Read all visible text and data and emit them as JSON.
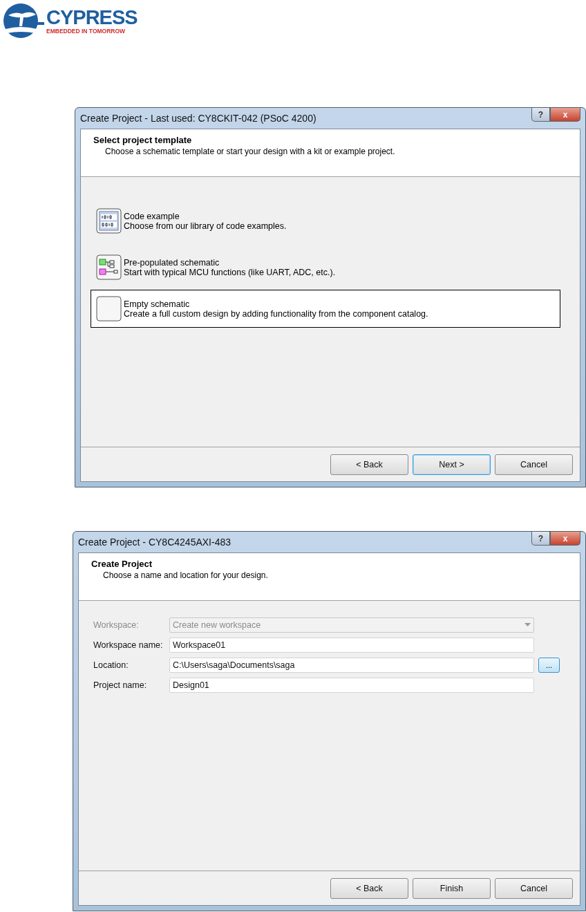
{
  "logo": {
    "name": "CYPRESS",
    "tagline": "EMBEDDED IN TOMORROW"
  },
  "template_dialog": {
    "title": "Create Project - Last used: CY8CKIT-042 (PSoC 4200)",
    "help": "?",
    "close": "x",
    "heading": "Select project template",
    "subheading": "Choose a schematic template or start your design with a kit or example project.",
    "templates": [
      {
        "kind": "code",
        "name": "Code example",
        "description": "Choose from our library of code examples.",
        "selected": false
      },
      {
        "kind": "schematic",
        "name": "Pre-populated schematic",
        "description": "Start with typical MCU functions (like UART, ADC, etc.).",
        "selected": false
      },
      {
        "kind": "empty",
        "name": "Empty schematic",
        "description": "Create a full custom design by adding functionality from the component catalog.",
        "selected": true
      }
    ],
    "buttons": [
      {
        "label": "< Back",
        "selected": false
      },
      {
        "label": "Next >",
        "selected": true
      },
      {
        "label": "Cancel",
        "selected": false
      }
    ]
  },
  "project_dialog": {
    "title": "Create Project - CY8C4245AXI-483",
    "help": "?",
    "close": "x",
    "heading": "Create Project",
    "subheading": "Choose a name and location for your design.",
    "fields": [
      {
        "kind": "dropdown",
        "label": "Workspace:",
        "value": "Create new workspace",
        "disabled": true
      },
      {
        "kind": "text",
        "label": "Workspace name:",
        "value": "Workspace01",
        "disabled": false
      },
      {
        "kind": "browse",
        "label": "Location:",
        "value": "C:\\Users\\saga\\Documents\\saga",
        "disabled": false,
        "button": "..."
      },
      {
        "kind": "text",
        "label": "Project name:",
        "value": "Design01",
        "disabled": false
      }
    ],
    "buttons": [
      {
        "label": "< Back",
        "selected": false
      },
      {
        "label": "Finish",
        "selected": false
      },
      {
        "label": "Cancel",
        "selected": false
      }
    ]
  }
}
